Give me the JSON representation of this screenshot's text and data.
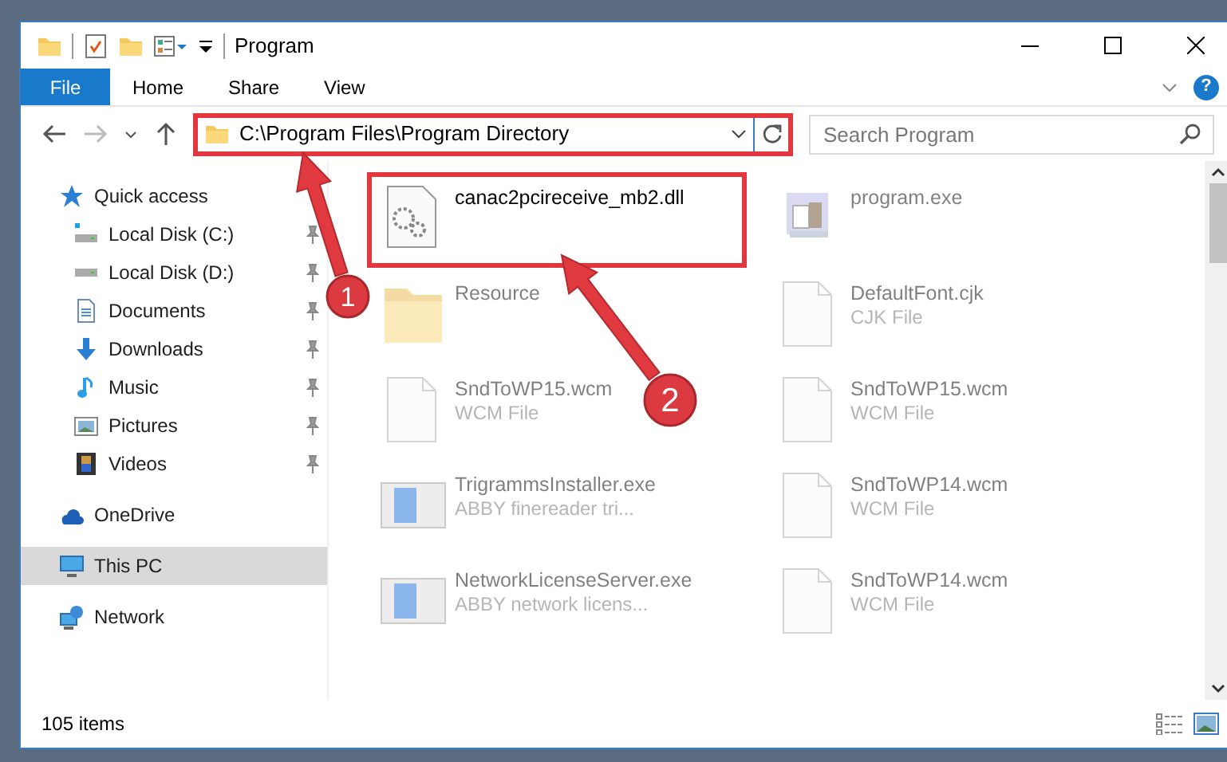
{
  "window": {
    "title": "Program"
  },
  "ribbon_tabs": [
    {
      "label": "File",
      "kind": "file_menu"
    },
    {
      "label": "Home",
      "kind": "tab"
    },
    {
      "label": "Share",
      "kind": "tab"
    },
    {
      "label": "View",
      "kind": "tab"
    }
  ],
  "help_button": {
    "label": "?"
  },
  "address": {
    "path": "C:\\Program Files\\Program Directory",
    "highlighted": true
  },
  "search": {
    "placeholder": "Search Program"
  },
  "nav_pane": [
    {
      "label": "Quick access",
      "kind": "star",
      "selected": false,
      "children": [
        {
          "label": "Local Disk (C:)",
          "kind": "system_drive",
          "pinned": true,
          "selected": false
        },
        {
          "label": "Local Disk (D:)",
          "kind": "drive",
          "pinned": true,
          "selected": false
        },
        {
          "label": "Documents",
          "kind": "documents",
          "pinned": true,
          "selected": false
        },
        {
          "label": "Downloads",
          "kind": "downloads",
          "pinned": true,
          "selected": false
        },
        {
          "label": "Music",
          "kind": "music",
          "pinned": true,
          "selected": false
        },
        {
          "label": "Pictures",
          "kind": "pictures",
          "pinned": true,
          "selected": false
        },
        {
          "label": "Videos",
          "kind": "videos",
          "pinned": true,
          "selected": false
        }
      ]
    },
    {
      "label": "OneDrive",
      "kind": "cloud",
      "selected": false
    },
    {
      "label": "This PC",
      "kind": "pc",
      "selected": true
    },
    {
      "label": "Network",
      "kind": "network",
      "selected": false
    }
  ],
  "files": [
    {
      "name": "canac2pcireceive_mb2.dll",
      "kind": "dll",
      "highlighted": true,
      "faded": false
    },
    {
      "name": "program.exe",
      "kind": "app",
      "highlighted": false,
      "faded": true
    },
    {
      "name": "Resource",
      "kind": "folder",
      "highlighted": false,
      "faded": true
    },
    {
      "name": "DefaultFont.cjk",
      "type": "CJK File",
      "kind": "file",
      "highlighted": false,
      "faded": true
    },
    {
      "name": "SndToWP15.wcm",
      "type": "WCM File",
      "kind": "file",
      "highlighted": false,
      "faded": true
    },
    {
      "name": "SndToWP15.wcm",
      "type": "WCM File",
      "kind": "file",
      "highlighted": false,
      "faded": true
    },
    {
      "name": "TrigrammsInstaller.exe",
      "type": "ABBY finereader tri...",
      "kind": "installer",
      "highlighted": false,
      "faded": true
    },
    {
      "name": "SndToWP14.wcm",
      "type": "WCM File",
      "kind": "file",
      "highlighted": false,
      "faded": true
    },
    {
      "name": "NetworkLicenseServer.exe",
      "type": "ABBY network licens...",
      "kind": "installer",
      "highlighted": false,
      "faded": true
    },
    {
      "name": "SndToWP14.wcm",
      "type": "WCM File",
      "kind": "file",
      "highlighted": false,
      "faded": true
    }
  ],
  "status_bar": {
    "item_count": "105 items"
  },
  "annotations": [
    {
      "number": "1"
    },
    {
      "number": "2"
    }
  ]
}
